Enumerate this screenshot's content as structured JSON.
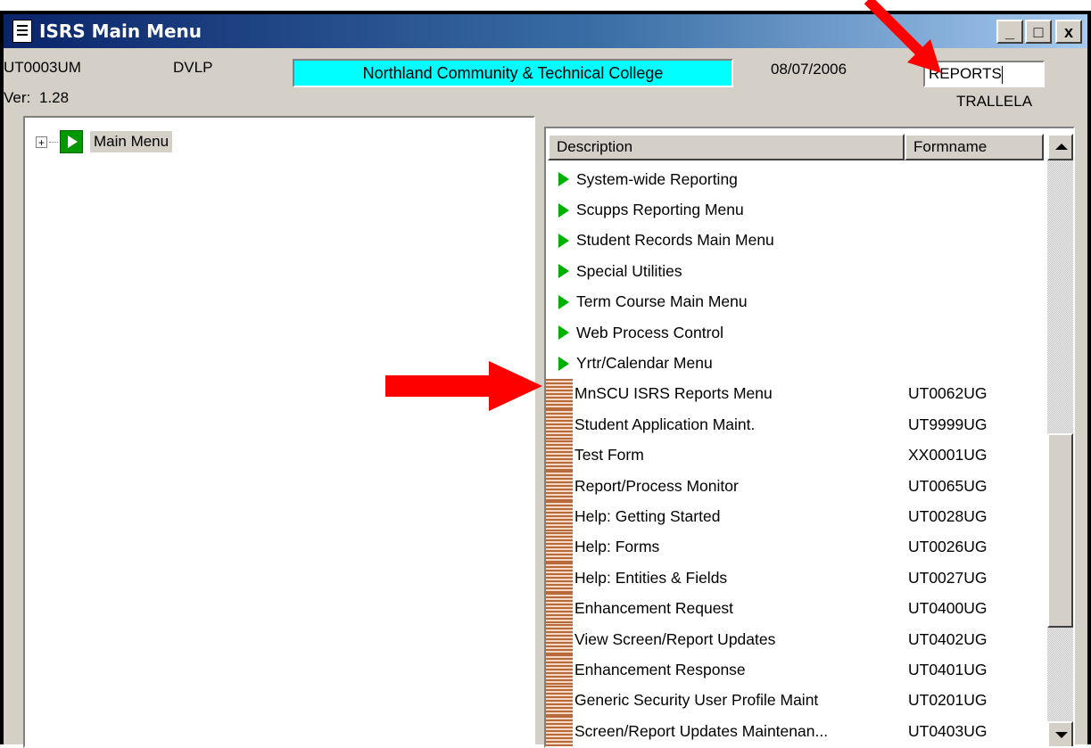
{
  "window": {
    "title": "ISRS Main Menu",
    "controls": {
      "minimize": "_",
      "maximize": "□",
      "close": "x"
    }
  },
  "header": {
    "screen_code": "UT0003UM",
    "environment": "DVLP",
    "college": "Northland Community & Technical College",
    "date": "08/07/2006",
    "search_value": "REPORTS",
    "version_label": "Ver:",
    "version": "1.28",
    "user": "TRALLELA"
  },
  "tree": {
    "root_label": "Main Menu",
    "expander": "+"
  },
  "list": {
    "columns": {
      "description": "Description",
      "formname": "Formname"
    },
    "rows": [
      {
        "type": "menu",
        "description": "System-wide Reporting",
        "formname": ""
      },
      {
        "type": "menu",
        "description": "Scupps Reporting Menu",
        "formname": ""
      },
      {
        "type": "menu",
        "description": "Student Records Main Menu",
        "formname": ""
      },
      {
        "type": "menu",
        "description": "Special Utilities",
        "formname": ""
      },
      {
        "type": "menu",
        "description": "Term Course Main Menu",
        "formname": ""
      },
      {
        "type": "menu",
        "description": "Web Process Control",
        "formname": ""
      },
      {
        "type": "menu",
        "description": "Yrtr/Calendar Menu",
        "formname": ""
      },
      {
        "type": "form",
        "description": "MnSCU ISRS Reports Menu",
        "formname": "UT0062UG"
      },
      {
        "type": "form",
        "description": "Student Application Maint.",
        "formname": "UT9999UG"
      },
      {
        "type": "form",
        "description": "Test Form",
        "formname": "XX0001UG"
      },
      {
        "type": "form",
        "description": "Report/Process Monitor",
        "formname": "UT0065UG"
      },
      {
        "type": "form",
        "description": "Help: Getting Started",
        "formname": "UT0028UG"
      },
      {
        "type": "form",
        "description": "Help: Forms",
        "formname": "UT0026UG"
      },
      {
        "type": "form",
        "description": "Help: Entities & Fields",
        "formname": "UT0027UG"
      },
      {
        "type": "form",
        "description": "Enhancement Request",
        "formname": "UT0400UG"
      },
      {
        "type": "form",
        "description": "View Screen/Report Updates",
        "formname": "UT0402UG"
      },
      {
        "type": "form",
        "description": "Enhancement Response",
        "formname": "UT0401UG"
      },
      {
        "type": "form",
        "description": "Generic Security User Profile Maint",
        "formname": "UT0201UG"
      },
      {
        "type": "form",
        "description": "Screen/Report Updates Maintenan...",
        "formname": "UT0403UG"
      }
    ]
  },
  "colors": {
    "college_box": "#00ffff",
    "annotation_arrow": "#ff0000",
    "menu_icon": "#00b000",
    "form_icon": "#b86a3c"
  },
  "icons": {
    "app": "document-icon",
    "menu_row": "green-arrow-icon",
    "form_row": "form-lines-icon"
  }
}
